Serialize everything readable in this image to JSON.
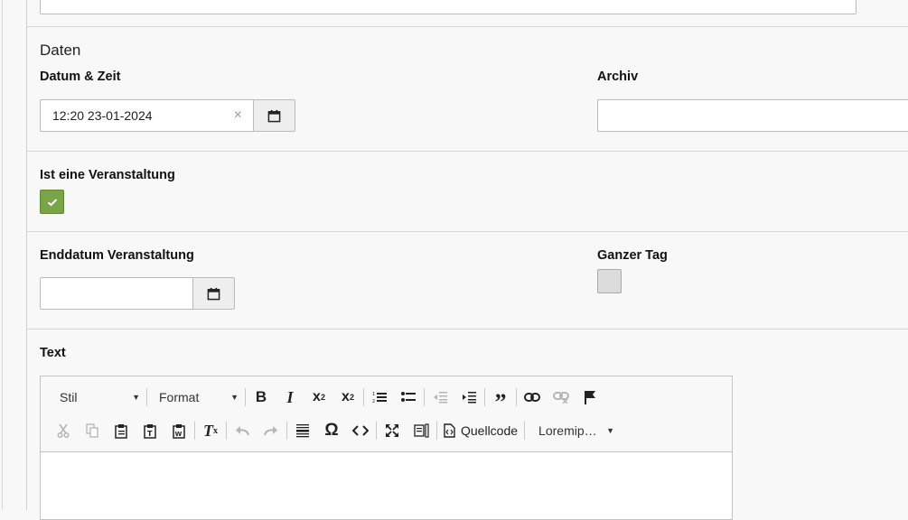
{
  "daten_section": {
    "title": "Daten",
    "datetime_label": "Datum & Zeit",
    "datetime_value": "12:20 23-01-2024",
    "clear_glyph": "×",
    "archiv_label": "Archiv",
    "archiv_value": ""
  },
  "event_section": {
    "is_event_label": "Ist eine Veranstaltung",
    "is_event_checked": true
  },
  "end_section": {
    "enddate_label": "Enddatum Veranstaltung",
    "enddate_value": "",
    "allday_label": "Ganzer Tag",
    "allday_checked": false
  },
  "text_section": {
    "label": "Text",
    "toolbar": {
      "style_combo": "Stil",
      "format_combo": "Format",
      "source_label": "Quellcode",
      "lorem_combo": "Loremip…",
      "icons_row1": [
        "bold-icon",
        "italic-icon",
        "subscript-icon",
        "superscript-icon",
        "numbered-list-icon",
        "bulleted-list-icon",
        "outdent-icon",
        "indent-icon",
        "blockquote-icon",
        "link-icon",
        "unlink-icon",
        "anchor-flag-icon"
      ],
      "icons_row2": [
        "cut-icon",
        "copy-icon",
        "paste-icon",
        "paste-text-icon",
        "paste-word-icon",
        "remove-format-icon",
        "undo-icon",
        "redo-icon",
        "horizontal-line-icon",
        "special-char-icon",
        "code-icon",
        "maximize-icon",
        "show-blocks-icon",
        "source-icon"
      ]
    }
  },
  "colors": {
    "checkbox_on": "#79a548",
    "background": "#f8f8f8",
    "border": "#bbbbbb"
  }
}
